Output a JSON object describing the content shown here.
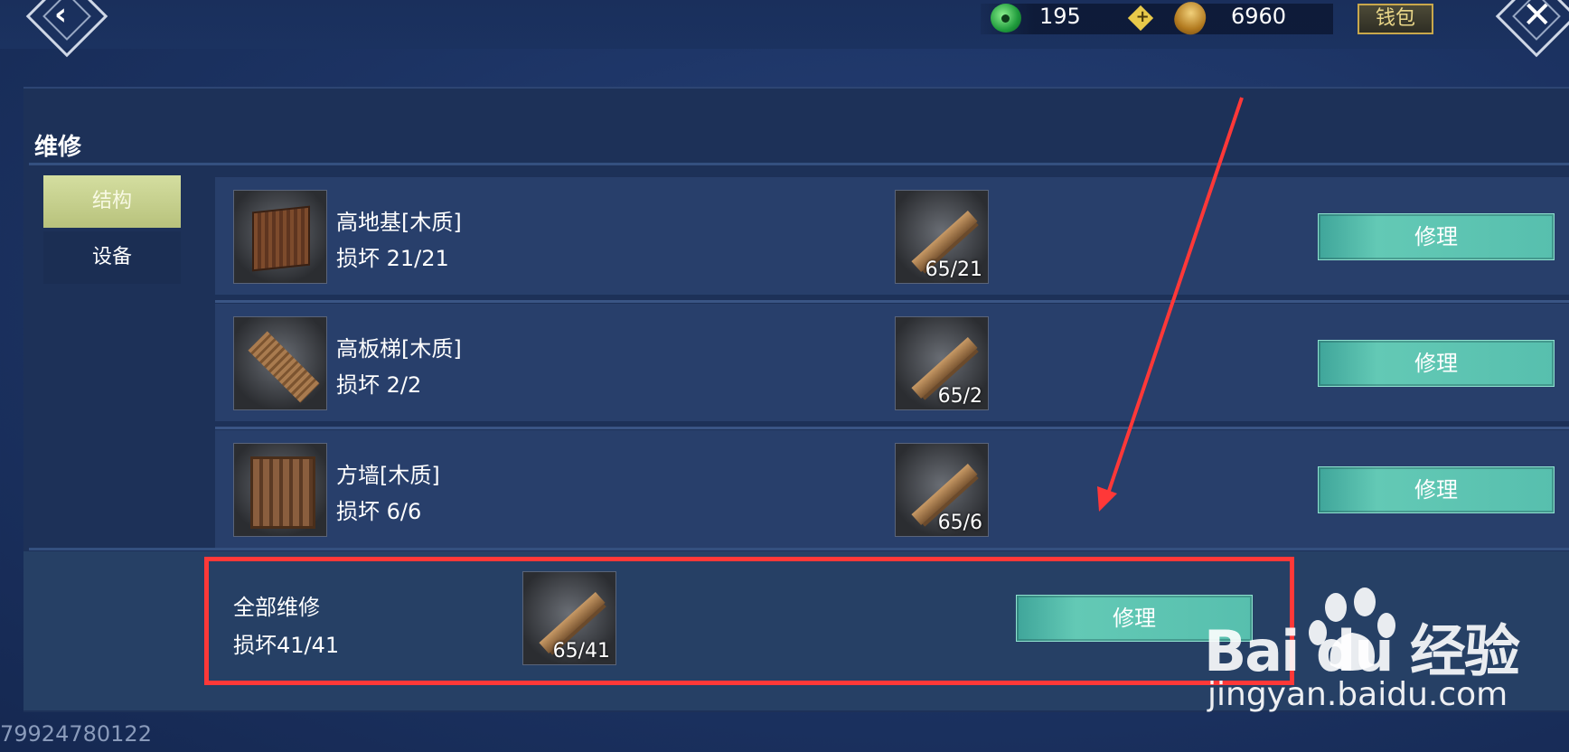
{
  "header": {
    "currencies": [
      {
        "icon": "jade-icon",
        "value": "195"
      },
      {
        "icon": "coin-icon",
        "value": "6960"
      }
    ],
    "wallet_label": "钱包"
  },
  "panel": {
    "title": "维修",
    "tabs": [
      {
        "label": "结构",
        "active": true
      },
      {
        "label": "设备",
        "active": false
      }
    ]
  },
  "items": [
    {
      "name": "高地基[木质]",
      "damage": "损坏 21/21",
      "material_count": "65/21",
      "button": "修理"
    },
    {
      "name": "高板梯[木质]",
      "damage": "损坏 2/2",
      "material_count": "65/2",
      "button": "修理"
    },
    {
      "name": "方墙[木质]",
      "damage": "损坏 6/6",
      "material_count": "65/6",
      "button": "修理"
    }
  ],
  "repair_all": {
    "label": "全部维修",
    "damage": "损坏41/41",
    "material_count": "65/41",
    "button": "修理"
  },
  "player_id": "79924780122",
  "watermark": {
    "logo_text": "Bai  du 经验",
    "url": "jingyan.baidu.com"
  },
  "colors": {
    "accent_button": "#57bfae",
    "active_tab": "#c8d290",
    "highlight_box": "#ff3838"
  }
}
